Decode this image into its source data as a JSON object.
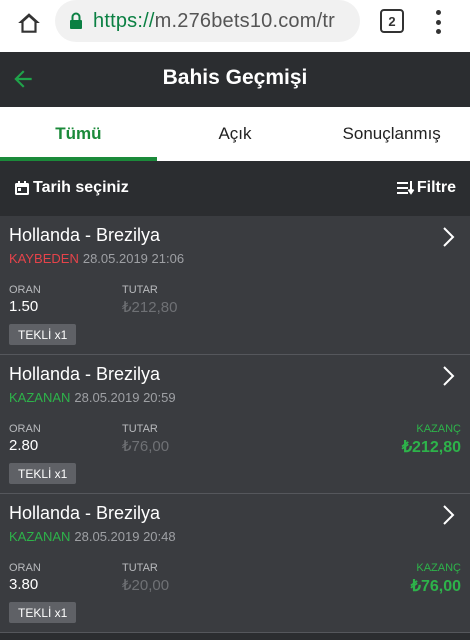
{
  "browser": {
    "url_scheme": "https://",
    "url_rest": "m.276bets10.com/tr",
    "tab_count": "2"
  },
  "header": {
    "title": "Bahis Geçmişi"
  },
  "tabs": [
    {
      "label": "Tümü",
      "active": true
    },
    {
      "label": "Açık",
      "active": false
    },
    {
      "label": "Sonuçlanmış",
      "active": false
    }
  ],
  "filters": {
    "date_label": "Tarih seçiniz",
    "filter_label": "Filtre"
  },
  "labels": {
    "oran": "ORAN",
    "tutar": "TUTAR",
    "kazanc": "KAZANÇ"
  },
  "colors": {
    "accent": "#1b8a3a",
    "won": "#2db34a",
    "lost": "#e6434a"
  },
  "bets": [
    {
      "match": "Hollanda - Brezilya",
      "status": "KAYBEDEN",
      "datetime": "28.05.2019 21:06",
      "oran": "1.50",
      "tutar": "₺212,80",
      "kazanc": "",
      "type": "TEKLİ x1"
    },
    {
      "match": "Hollanda - Brezilya",
      "status": "KAZANAN",
      "datetime": "28.05.2019 20:59",
      "oran": "2.80",
      "tutar": "₺76,00",
      "kazanc": "₺212,80",
      "type": "TEKLİ x1"
    },
    {
      "match": "Hollanda - Brezilya",
      "status": "KAZANAN",
      "datetime": "28.05.2019 20:48",
      "oran": "3.80",
      "tutar": "₺20,00",
      "kazanc": "₺76,00",
      "type": "TEKLİ x1"
    }
  ]
}
